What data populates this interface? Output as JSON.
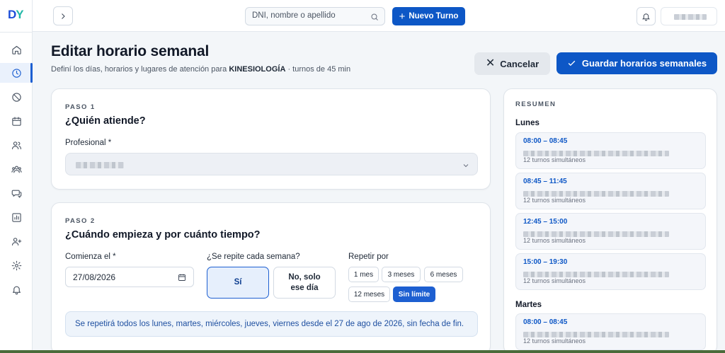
{
  "brand": {
    "logo_d": "D",
    "logo_y": "Y"
  },
  "sidebar": {
    "items": [
      {
        "name": "home-icon"
      },
      {
        "name": "clock-icon",
        "active": true
      },
      {
        "name": "ban-icon"
      },
      {
        "name": "calendar-icon"
      },
      {
        "name": "users-icon"
      },
      {
        "name": "group-icon"
      },
      {
        "name": "chat-icon"
      },
      {
        "name": "chart-icon"
      },
      {
        "name": "team-icon"
      },
      {
        "name": "gear-icon"
      },
      {
        "name": "bell-icon"
      }
    ]
  },
  "topbar": {
    "search_placeholder": "DNI, nombre o apellido",
    "new_button": "Nuevo Turno"
  },
  "header": {
    "title": "Editar horario semanal",
    "subtitle_prefix": "Definí los días, horarios y lugares de atención para",
    "specialty": "KINESIOLOGÍA",
    "subtitle_suffix": "· turnos de 45 min",
    "cancel_label": "Cancelar",
    "save_label": "Guardar horarios semanales"
  },
  "step1": {
    "label": "PASO 1",
    "title": "¿Quién atiende?",
    "field_label": "Profesional *"
  },
  "step2": {
    "label": "PASO 2",
    "title": "¿Cuándo empieza y por cuánto tiempo?",
    "start_label": "Comienza el *",
    "start_value": "27/08/2026",
    "repeat_label": "¿Se repite cada semana?",
    "yes_label": "Sí",
    "no_label_1": "No, solo",
    "no_label_2": "ese día",
    "repeat_for_label": "Repetir por",
    "options": [
      "1 mes",
      "3 meses",
      "6 meses",
      "12 meses",
      "Sin límite"
    ],
    "selected_option": "Sin límite",
    "info": "Se repetirá todos los lunes, martes, miércoles, jueves, viernes desde el 27 de ago de 2026, sin fecha de fin."
  },
  "summary": {
    "heading": "RESUMEN",
    "days": [
      {
        "day": "Lunes",
        "slots": [
          {
            "time": "08:00 – 08:45",
            "sub": "12 turnos simultáneos"
          },
          {
            "time": "08:45 – 11:45",
            "sub": "12 turnos simultáneos"
          },
          {
            "time": "12:45 – 15:00",
            "sub": "12 turnos simultáneos"
          },
          {
            "time": "15:00 – 19:30",
            "sub": "12 turnos simultáneos"
          }
        ]
      },
      {
        "day": "Martes",
        "slots": [
          {
            "time": "08:00 – 08:45",
            "sub": "12 turnos simultáneos"
          }
        ]
      }
    ]
  },
  "colors": {
    "primary": "#0d57c6",
    "background": "#f3f6f9",
    "info_text": "#1e4fa0"
  }
}
